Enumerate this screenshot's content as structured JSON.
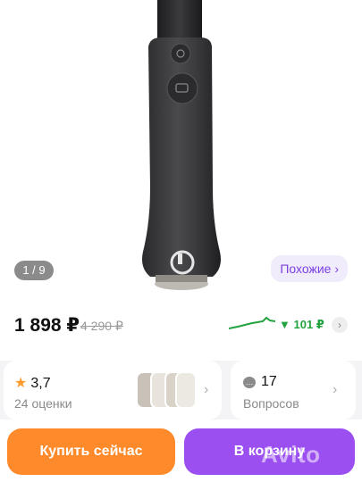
{
  "gallery": {
    "page_indicator": "1 / 9",
    "similar_label": "Похожие ›",
    "product_logo_icon": "brand-logo-icon"
  },
  "price": {
    "current": "1 898 ₽",
    "old": "4 290 ₽",
    "drop": "▼ 101 ₽",
    "chevron": "›",
    "trend_color": "#23a33f"
  },
  "rating_card": {
    "rating": "3,7",
    "reviews": "24 оценки",
    "chevron": "›"
  },
  "questions_card": {
    "count": "17",
    "label": "Вопросов",
    "chevron": "›"
  },
  "actions": {
    "buy_label": "Купить сейчас",
    "cart_label": "В корзину",
    "buy_color": "#ff8a2b",
    "cart_color": "#9b4ff0"
  },
  "watermark": "Avito"
}
